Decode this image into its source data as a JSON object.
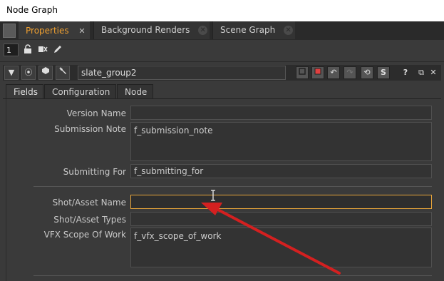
{
  "window": {
    "title": "Node Graph"
  },
  "tabs": [
    {
      "label": "Properties",
      "close": "✕"
    },
    {
      "label": "Background Renders",
      "close": "✕"
    },
    {
      "label": "Scene Graph",
      "close": "✕"
    }
  ],
  "toolbar": {
    "panel_count": "1"
  },
  "node": {
    "name": "slate_group2",
    "s_button": "S",
    "help_button": "?"
  },
  "subtabs": [
    "Fields",
    "Configuration",
    "Node"
  ],
  "fields": {
    "version_name": {
      "label": "Version Name",
      "value": ""
    },
    "submission_note": {
      "label": "Submission Note",
      "value": "f_submission_note"
    },
    "submitting_for": {
      "label": "Submitting For",
      "value": "f_submitting_for"
    },
    "shot_asset_name": {
      "label": "Shot/Asset Name",
      "value": ""
    },
    "shot_asset_types": {
      "label": "Shot/Asset Types",
      "value": ""
    },
    "vfx_scope": {
      "label": "VFX Scope Of Work",
      "value": "f_vfx_scope_of_work"
    }
  },
  "colors": {
    "accent": "#f0a030",
    "annotation_arrow": "#d42020",
    "focus_border": "#e8a53a"
  },
  "icons": [
    "lock-icon",
    "bypass-icon",
    "pencil-icon",
    "node-icon",
    "viewer-icon",
    "gizmo-icon",
    "undo-icon",
    "redo-icon",
    "revert-icon",
    "float-icon",
    "close-icon"
  ]
}
